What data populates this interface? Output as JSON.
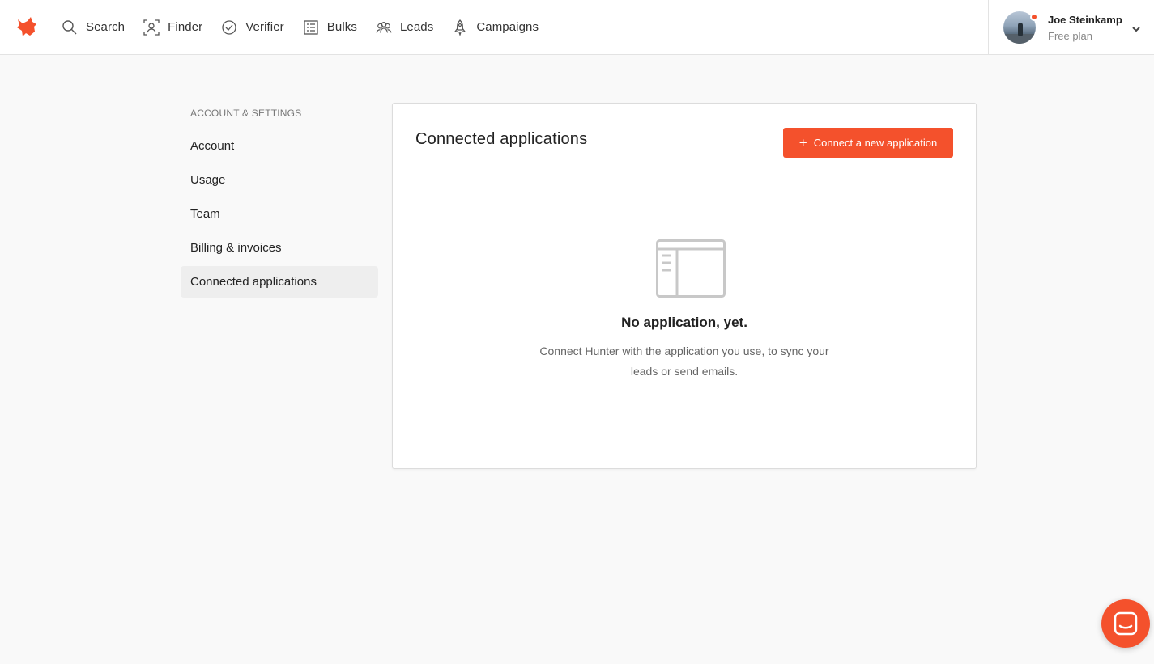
{
  "brand": {
    "accent": "#f4512c",
    "logo_icon": "fox-logo-icon"
  },
  "nav": [
    {
      "label": "Search",
      "icon": "search-icon"
    },
    {
      "label": "Finder",
      "icon": "finder-icon"
    },
    {
      "label": "Verifier",
      "icon": "verifier-icon"
    },
    {
      "label": "Bulks",
      "icon": "bulks-icon"
    },
    {
      "label": "Leads",
      "icon": "leads-icon"
    },
    {
      "label": "Campaigns",
      "icon": "campaigns-icon"
    }
  ],
  "user": {
    "name": "Joe Steinkamp",
    "plan": "Free plan"
  },
  "sidebar": {
    "heading": "ACCOUNT & SETTINGS",
    "items": [
      {
        "label": "Account"
      },
      {
        "label": "Usage"
      },
      {
        "label": "Team"
      },
      {
        "label": "Billing & invoices"
      },
      {
        "label": "Connected applications",
        "active": true
      }
    ]
  },
  "main": {
    "title": "Connected applications",
    "connect_button": "Connect a new application",
    "empty_title": "No application, yet.",
    "empty_text": "Connect Hunter with the application you use, to sync your leads or send emails."
  }
}
